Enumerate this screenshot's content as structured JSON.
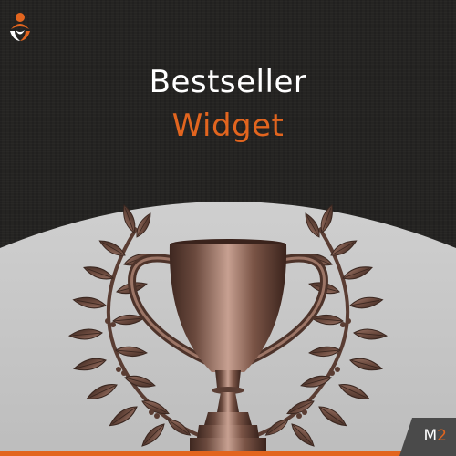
{
  "title": {
    "line1": "Bestseller",
    "line2": "Widget"
  },
  "badge": {
    "letter": "M",
    "number": "2"
  },
  "colors": {
    "accent": "#e2651f",
    "background_dark": "#252422",
    "background_light": "#c9c9c9",
    "trophy": "#6e4a3c"
  },
  "icons": [
    "brand-logo-icon",
    "trophy-icon",
    "laurel-wreath-icon"
  ]
}
